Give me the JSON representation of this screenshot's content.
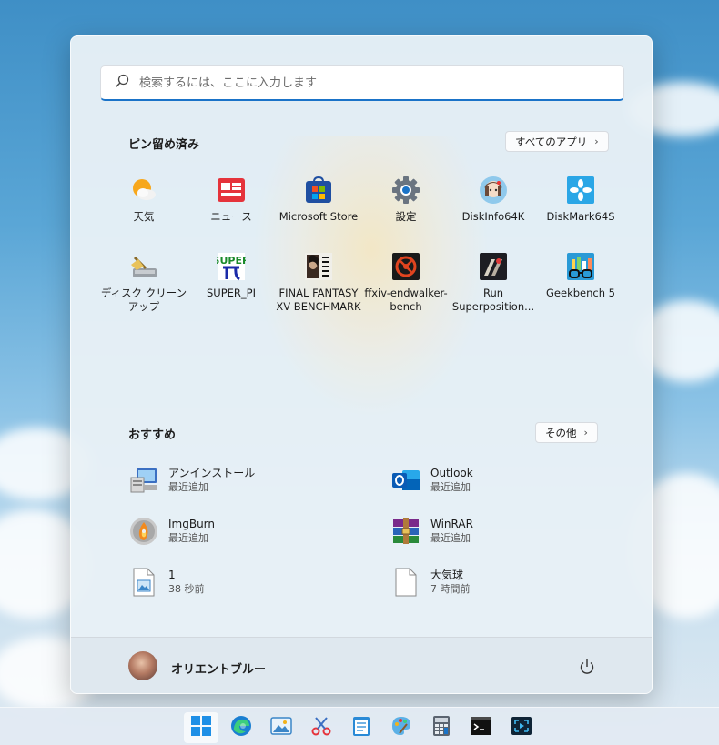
{
  "search": {
    "placeholder": "検索するには、ここに入力します"
  },
  "pinned": {
    "title": "ピン留め済み",
    "all_apps_label": "すべてのアプリ",
    "apps": [
      {
        "label": "天気",
        "icon": "weather-icon"
      },
      {
        "label": "ニュース",
        "icon": "news-icon"
      },
      {
        "label": "Microsoft Store",
        "icon": "store-icon"
      },
      {
        "label": "設定",
        "icon": "gear-icon"
      },
      {
        "label": "DiskInfo64K",
        "icon": "diskinfo-icon"
      },
      {
        "label": "DiskMark64S",
        "icon": "diskmark-icon"
      },
      {
        "label": "ディスク クリーンアップ",
        "icon": "disk-cleanup-icon"
      },
      {
        "label": "SUPER_PI",
        "icon": "superpi-icon"
      },
      {
        "label": "FINAL FANTASY XV BENCHMARK",
        "icon": "ffxv-icon"
      },
      {
        "label": "ffxiv-endwalker-bench",
        "icon": "ffxiv-icon"
      },
      {
        "label": "Run Superposition...",
        "icon": "superposition-icon"
      },
      {
        "label": "Geekbench 5",
        "icon": "geekbench-icon"
      }
    ]
  },
  "recommended": {
    "title": "おすすめ",
    "more_label": "その他",
    "items": [
      {
        "name": "アンインストール",
        "sub": "最近追加",
        "icon": "uninstall-icon"
      },
      {
        "name": "Outlook",
        "sub": "最近追加",
        "icon": "outlook-icon"
      },
      {
        "name": "ImgBurn",
        "sub": "最近追加",
        "icon": "imgburn-icon"
      },
      {
        "name": "WinRAR",
        "sub": "最近追加",
        "icon": "winrar-icon"
      },
      {
        "name": "1",
        "sub": "38 秒前",
        "icon": "image-file-icon"
      },
      {
        "name": "大気球",
        "sub": "7 時間前",
        "icon": "document-icon"
      }
    ]
  },
  "user": {
    "name": "オリエントブルー"
  },
  "taskbar": {
    "items": [
      "start-icon",
      "edge-icon",
      "photos-icon",
      "snipping-tool-icon",
      "notepad-icon",
      "paint-icon",
      "calculator-icon",
      "terminal-icon",
      "quick-assist-icon"
    ]
  },
  "colors": {
    "accent": "#1a73c8",
    "menu_bg": "#e8f0f6"
  }
}
